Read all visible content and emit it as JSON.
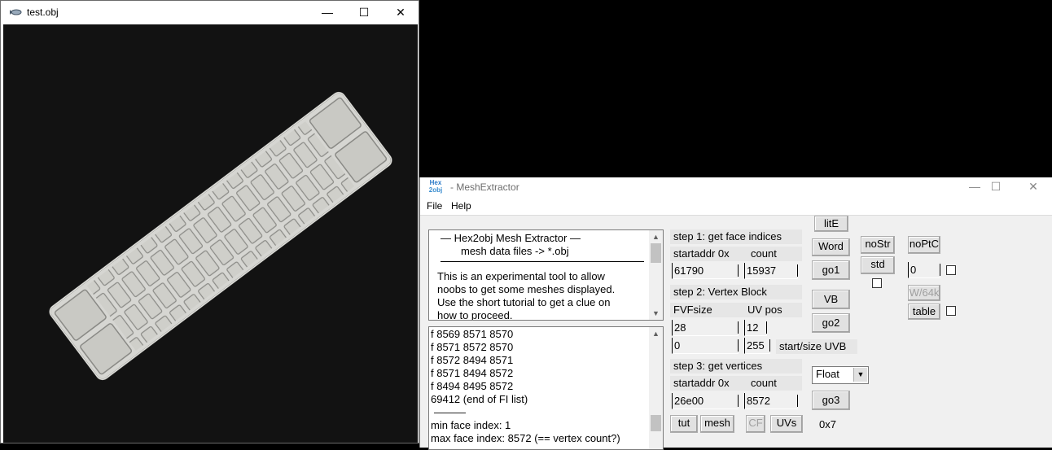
{
  "viewer": {
    "title": "test.obj",
    "minimize_glyph": "—",
    "maximize_glyph": "☐",
    "close_glyph": "✕"
  },
  "mesh_extractor": {
    "title": "- MeshExtractor",
    "icon_top": "Hex",
    "icon_bottom": "2obj",
    "menu": [
      "File",
      "Help"
    ],
    "intro_lines": [
      "—   Hex2obj Mesh Extractor   —",
      "mesh data files -> *.obj",
      "This is an experimental tool to allow",
      "noobs to get some meshes displayed.",
      "Use the short tutorial to get a clue on",
      "how to proceed."
    ],
    "log_lines": [
      "f  8569 8571 8570",
      "f  8571 8572 8570",
      "f  8572 8494 8571",
      "f  8571 8494 8572",
      "f  8494 8495 8572",
      "69412 (end of FI list)",
      "———",
      "min face index: 1",
      "max face index: 8572 (== vertex count?)"
    ],
    "step1": {
      "header": "step 1: get face indices",
      "startaddr_label": "startaddr 0x",
      "count_label": "count",
      "startaddr_value": "61790",
      "count_value": "15937"
    },
    "step2": {
      "header": "step 2: Vertex Block",
      "fvfsize_label": "FVFsize",
      "uvpos_label": "UV pos",
      "fvfsize_value": "28",
      "uvpos_value": "12",
      "uvb_start_value": "0",
      "uvb_size_value": "255",
      "uvb_label": "start/size UVB"
    },
    "step3": {
      "header": "step 3: get vertices",
      "startaddr_label": "startaddr 0x",
      "count_label": "count",
      "startaddr_value": "26e00",
      "count_value": "8572"
    },
    "buttons": {
      "lite": "litE",
      "word": "Word",
      "go1": "go1",
      "vb": "VB",
      "go2": "go2",
      "go3": "go3",
      "nostr": "noStr",
      "std": "std",
      "noptc": "noPtC",
      "w64": "W/64k",
      "table": "table",
      "tut": "tut",
      "mesh": "mesh",
      "cf": "CF",
      "uvs": "UVs"
    },
    "noptc_value": "0",
    "format_select": "Float",
    "bottom_label": "0x7"
  }
}
